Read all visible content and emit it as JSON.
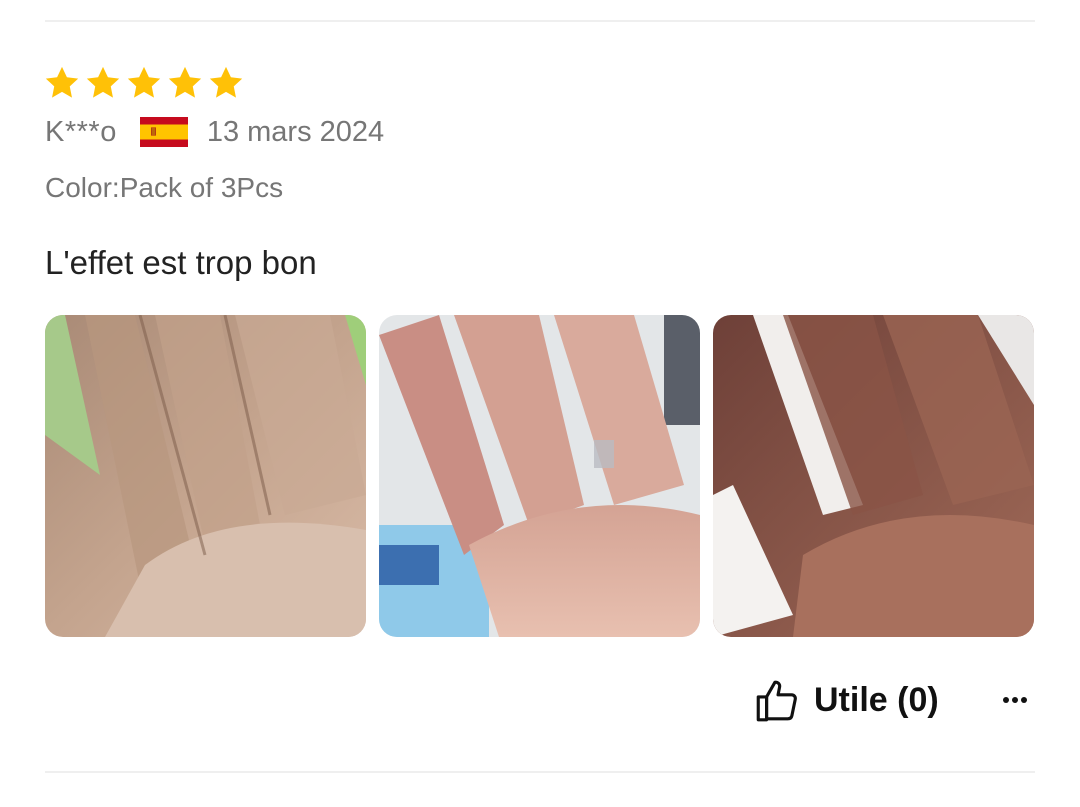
{
  "review": {
    "rating": 5,
    "rating_max": 5,
    "reviewer": "K***o",
    "country_flag": "spain-flag-icon",
    "date": "13 mars 2024",
    "variant": "Color:Pack of 3Pcs",
    "text": "L'effet est trop bon",
    "photos": [
      {
        "icon": "review-photo-hand-1"
      },
      {
        "icon": "review-photo-hand-2"
      },
      {
        "icon": "review-photo-hand-3"
      }
    ],
    "helpful_label": "Utile (0)",
    "more_icon": "more-options-icon"
  },
  "colors": {
    "star": "#FFC107",
    "secondary_text": "#767676",
    "primary_text": "#222222",
    "divider": "#EFEFEF"
  }
}
